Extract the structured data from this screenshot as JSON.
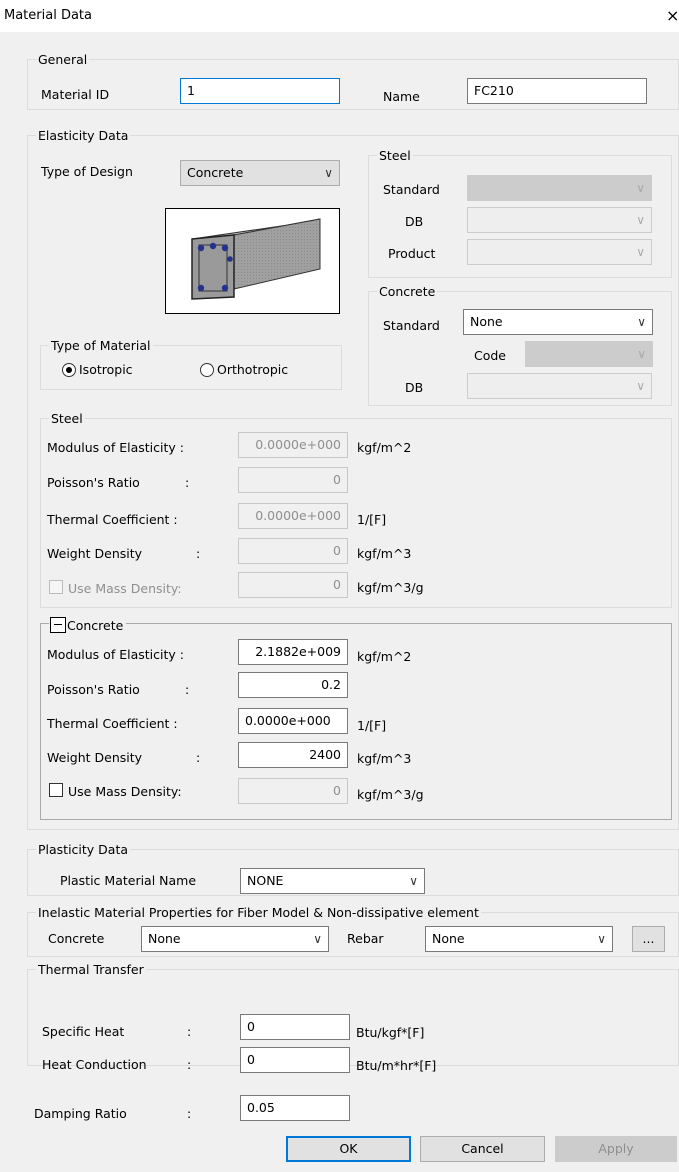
{
  "window": {
    "title": "Material Data",
    "close": "×"
  },
  "general": {
    "legend": "General",
    "material_id_label": "Material ID",
    "material_id_value": "1",
    "name_label": "Name",
    "name_value": "FC210"
  },
  "elasticity": {
    "legend": "Elasticity Data",
    "type_of_design_label": "Type of Design",
    "type_of_design_value": "Concrete"
  },
  "steel_std": {
    "legend": "Steel",
    "standard_label": "Standard",
    "db_label": "DB",
    "product_label": "Product"
  },
  "concrete_std": {
    "legend": "Concrete",
    "standard_label": "Standard",
    "standard_value": "None",
    "code_label": "Code",
    "db_label": "DB"
  },
  "type_of_material": {
    "legend": "Type of Material",
    "isotropic": "Isotropic",
    "orthotropic": "Orthotropic",
    "selected": "Isotropic"
  },
  "steel_props": {
    "legend": "Steel",
    "rows": [
      {
        "label": "Modulus of Elasticity :",
        "value": "0.0000e+000",
        "unit": "kgf/m^2"
      },
      {
        "label": "Poisson's Ratio",
        "colon": ":",
        "value": "0",
        "unit": ""
      },
      {
        "label": "Thermal Coefficient :",
        "value": "0.0000e+000",
        "unit": "1/[F]"
      },
      {
        "label": "Weight Density",
        "colon": ":",
        "value": "0",
        "unit": "kgf/m^3"
      }
    ],
    "mass_density_label": "Use Mass Density:",
    "mass_density_value": "0",
    "mass_density_unit": "kgf/m^3/g"
  },
  "concrete_props": {
    "legend": "Concrete",
    "collapse_symbol": "—",
    "rows": [
      {
        "label": "Modulus of Elasticity :",
        "value": "2.1882e+009",
        "unit": "kgf/m^2"
      },
      {
        "label": "Poisson's Ratio",
        "colon": ":",
        "value": "0.2",
        "unit": ""
      },
      {
        "label": "Thermal Coefficient :",
        "value": "0.0000e+000",
        "unit": "1/[F]"
      },
      {
        "label": "Weight Density",
        "colon": ":",
        "value": "2400",
        "unit": "kgf/m^3"
      }
    ],
    "mass_density_label": "Use Mass Density:",
    "mass_density_value": "0",
    "mass_density_unit": "kgf/m^3/g"
  },
  "plasticity": {
    "legend": "Plasticity Data",
    "plastic_material_label": "Plastic Material Name",
    "plastic_material_value": "NONE"
  },
  "inelastic": {
    "legend": "Inelastic Material Properties for Fiber Model & Non-dissipative element",
    "concrete_label": "Concrete",
    "concrete_value": "None",
    "rebar_label": "Rebar",
    "rebar_value": "None",
    "more_button": "..."
  },
  "thermal": {
    "legend": "Thermal Transfer",
    "specific_heat_label": "Specific Heat",
    "specific_heat_value": "0",
    "specific_heat_unit": "Btu/kgf*[F]",
    "heat_conduction_label": "Heat Conduction",
    "heat_conduction_value": "0",
    "heat_conduction_unit": "Btu/m*hr*[F]",
    "colon": ":"
  },
  "damping": {
    "label": "Damping Ratio",
    "colon": ":",
    "value": "0.05"
  },
  "buttons": {
    "ok": "OK",
    "cancel": "Cancel",
    "apply": "Apply"
  },
  "icons": {
    "dropdown": "chevron-down-icon",
    "close": "close-icon",
    "beam_image": "concrete-beam-icon"
  }
}
